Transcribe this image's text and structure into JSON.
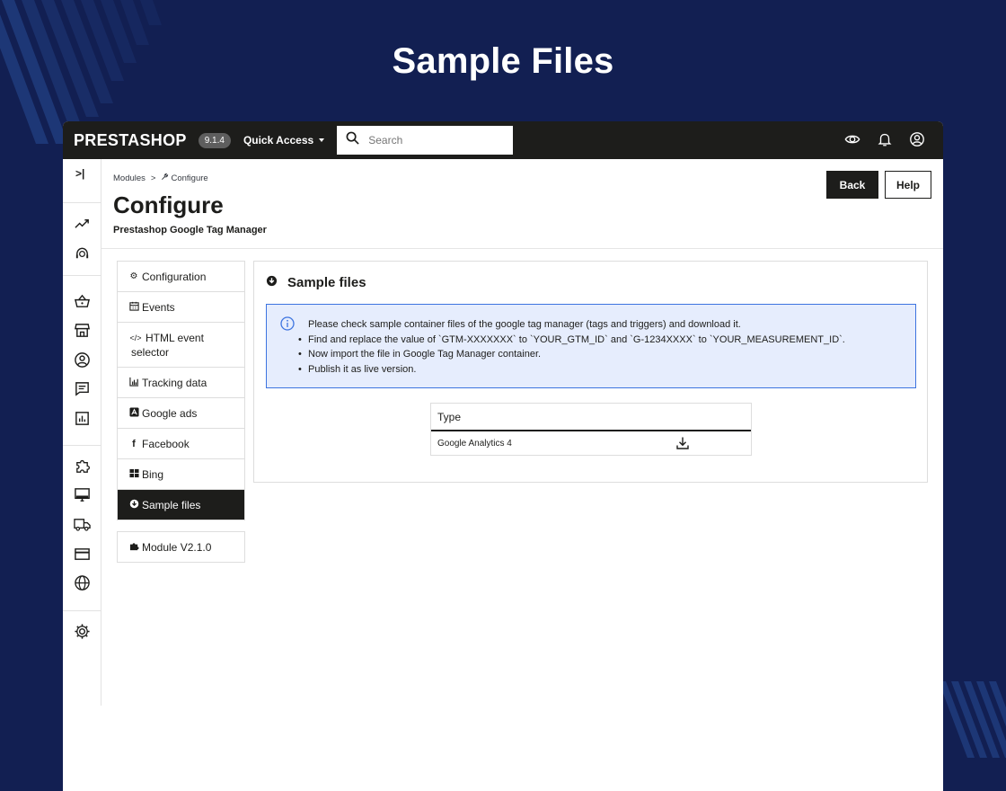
{
  "page": {
    "heading": "Sample Files"
  },
  "topbar": {
    "logo": "PRESTASHOP",
    "version": "9.1.4",
    "quick_access": "Quick Access",
    "search_placeholder": "Search",
    "icons": [
      "eye-icon",
      "bell-icon",
      "user-circle-icon"
    ]
  },
  "sidebar": {
    "toggle": ">|",
    "icons": [
      "trend-icon",
      "support-icon",
      "basket-icon",
      "store-icon",
      "customer-icon",
      "messages-icon",
      "stats-icon",
      "puzzle-icon",
      "monitor-icon",
      "truck-icon",
      "card-icon",
      "globe-icon",
      "settings-icon"
    ]
  },
  "header": {
    "breadcrumb": {
      "parent": "Modules",
      "separator": ">",
      "current": "Configure"
    },
    "title": "Configure",
    "subtitle": "Prestashop Google Tag Manager",
    "back_label": "Back",
    "help_label": "Help"
  },
  "menu": {
    "items": [
      {
        "icon": "gears-icon",
        "label": "Configuration"
      },
      {
        "icon": "calendar-icon",
        "label": "Events"
      },
      {
        "icon": "code-icon",
        "label": "HTML event selector"
      },
      {
        "icon": "bar-chart-icon",
        "label": "Tracking data"
      },
      {
        "icon": "google-ads-icon",
        "label": "Google ads"
      },
      {
        "icon": "facebook-icon",
        "label": "Facebook"
      },
      {
        "icon": "windows-icon",
        "label": "Bing"
      },
      {
        "icon": "download-circle-icon",
        "label": "Sample files"
      }
    ],
    "module_version": "Module V2.1.0"
  },
  "panel": {
    "title": "Sample files",
    "info": {
      "intro": "Please check sample container files of the google tag manager (tags and triggers) and download it.",
      "bullets": [
        "Find and replace the value of `GTM-XXXXXXX` to `YOUR_GTM_ID` and `G-1234XXXX` to `YOUR_MEASUREMENT_ID`.",
        "Now import the file in Google Tag Manager container.",
        "Publish it as live version."
      ]
    },
    "table": {
      "header": "Type",
      "rows": [
        {
          "type": "Google Analytics 4"
        }
      ]
    }
  },
  "colors": {
    "background": "#121f52",
    "topbar": "#1d1d1b",
    "info_bg": "#e6edfd",
    "info_border": "#3d74e0"
  }
}
